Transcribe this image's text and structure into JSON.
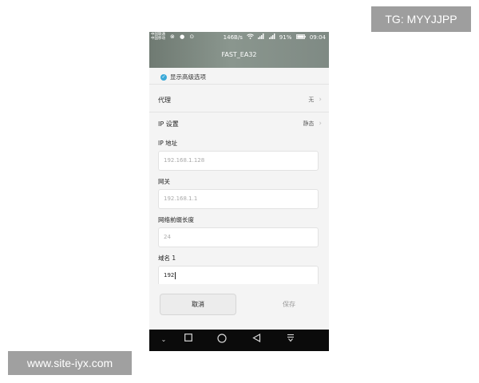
{
  "status_bar": {
    "carrier_top": "中国联通",
    "carrier_bottom": "中国移动",
    "left_icons": "⊗ ● ⊙",
    "speed": "146B/s",
    "battery": "91%",
    "time": "09:04"
  },
  "header": {
    "title": "FAST_EA32"
  },
  "advanced": {
    "label": "显示高级选项",
    "checked": true
  },
  "proxy": {
    "label": "代理",
    "value": "无"
  },
  "ip_settings": {
    "label": "IP 设置",
    "value": "静态"
  },
  "fields": [
    {
      "label": "IP 地址",
      "value": "192.168.1.128",
      "state": "placeholder"
    },
    {
      "label": "网关",
      "value": "192.168.1.1",
      "state": "placeholder"
    },
    {
      "label": "网络前缀长度",
      "value": "24",
      "state": "placeholder"
    },
    {
      "label": "域名 1",
      "value": "192",
      "state": "editing"
    }
  ],
  "buttons": {
    "cancel": "取消",
    "save": "保存"
  },
  "navbar": {
    "icons": [
      "chevron-down-icon",
      "square-icon",
      "circle-icon",
      "back-triangle-icon",
      "notification-pull-icon"
    ]
  },
  "watermarks": {
    "tg": "TG: MYYJJPP",
    "site": "www.site-iyx.com"
  },
  "colors": {
    "accent": "#3aa9d8",
    "header": "#7f8a84",
    "navbar": "#0b0b0b"
  }
}
